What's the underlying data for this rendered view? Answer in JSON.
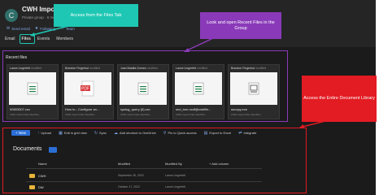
{
  "group": {
    "avatar": "C",
    "title": "CWH Import Files",
    "subtitle": "Private group · 6 members"
  },
  "actions": [
    {
      "icon": "mail-icon",
      "label": "Send email"
    },
    {
      "icon": "follow-icon",
      "label": "Following"
    },
    {
      "icon": "team-icon",
      "label": "Team"
    }
  ],
  "tabs": [
    "Email",
    "Files",
    "Events",
    "Members"
  ],
  "recent": {
    "label": "Recent files",
    "cards": [
      {
        "user": "Lance Lingerfelt",
        "note": "modified",
        "name": "00503307.csv",
        "sub": "CWH Import Files Site/Sha...",
        "kind": "csv"
      },
      {
        "user": "Brandon Fingerhut",
        "note": "modified",
        "name": "How to - Configure an...",
        "sub": "CWH Import Files Site/Sha...",
        "kind": "pdf"
      },
      {
        "user": "Juan Batalla Gomez",
        "note": "modified",
        "name": "syslog_query (6).csv",
        "sub": "CWH Import Files Site/Sha...",
        "kind": "csv"
      },
      {
        "user": "Lance Lingerfelt",
        "note": "modified",
        "name": "snd_tom.ncdf@cwhfile...",
        "sub": "CWH Import Files Site/Sha...",
        "kind": "csv"
      },
      {
        "user": "Brandon Fingerhut",
        "note": "modified",
        "name": "azcopy.exe",
        "sub": "CWH Import Files Site/Sha...",
        "kind": "csv"
      }
    ]
  },
  "toolbar": {
    "new": "+ New",
    "items": [
      {
        "icon": "upload-icon",
        "label": "Upload"
      },
      {
        "icon": "grid-icon",
        "label": "Edit in grid view"
      },
      {
        "icon": "sync-icon",
        "label": "Sync"
      },
      {
        "icon": "onedrive-icon",
        "label": "Add shortcut to OneDrive"
      },
      {
        "icon": "pin-icon",
        "label": "Pin to Quick access"
      },
      {
        "icon": "excel-icon",
        "label": "Export to Excel"
      },
      {
        "icon": "integrate-icon",
        "label": "Integrate"
      }
    ]
  },
  "library": {
    "title": "Documents",
    "columns": [
      "Name",
      "Modified",
      "Modified By",
      "+ Add column"
    ],
    "rows": [
      {
        "name": "CWH",
        "modified": "September 26, 2022",
        "by": "Lance Lingerfelt"
      },
      {
        "name": "DW",
        "modified": "October 17, 2022",
        "by": "Lance Lingerfelt"
      }
    ]
  },
  "callouts": {
    "files_tab": "Access from the Files Tab",
    "recent": "Look and open Recent Files in the Group",
    "library": "Access the Entire Document Library"
  },
  "colors": {
    "teal": "#1ec7b3",
    "purple": "#8a3ab9",
    "red": "#e31b23",
    "accent_blue": "#2b6fd6"
  }
}
